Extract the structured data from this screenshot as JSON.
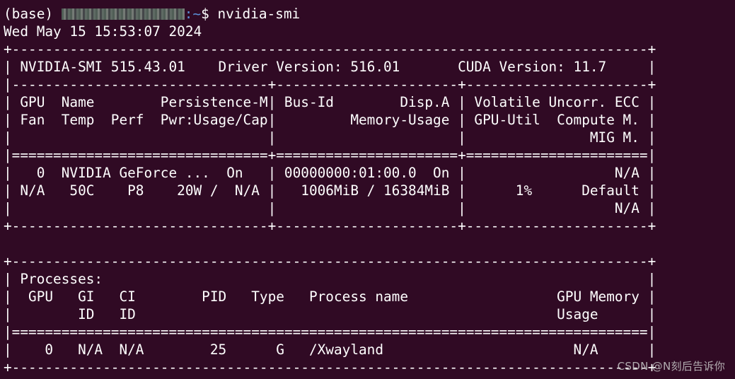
{
  "prompt": {
    "env": "(base) ",
    "path": ":~",
    "symbol": "$ ",
    "command": "nvidia-smi"
  },
  "output_lines": [
    "Wed May 15 15:53:07 2024",
    "+-----------------------------------------------------------------------------+",
    "| NVIDIA-SMI 515.43.01    Driver Version: 516.01       CUDA Version: 11.7     |",
    "|-------------------------------+----------------------+----------------------+",
    "| GPU  Name        Persistence-M| Bus-Id        Disp.A | Volatile Uncorr. ECC |",
    "| Fan  Temp  Perf  Pwr:Usage/Cap|         Memory-Usage | GPU-Util  Compute M. |",
    "|                               |                      |               MIG M. |",
    "|===============================+======================+======================|",
    "|   0  NVIDIA GeForce ...  On   | 00000000:01:00.0  On |                  N/A |",
    "| N/A   50C    P8    20W /  N/A |   1006MiB / 16384MiB |      1%      Default |",
    "|                               |                      |                  N/A |",
    "+-------------------------------+----------------------+----------------------+",
    "",
    "+-----------------------------------------------------------------------------+",
    "| Processes:                                                                  |",
    "|  GPU   GI   CI        PID   Type   Process name                  GPU Memory |",
    "|        ID   ID                                                   Usage      |",
    "|=============================================================================|",
    "|    0   N/A  N/A        25      G   /Xwayland                       N/A      |",
    "+-----------------------------------------------------------------------------+"
  ],
  "watermark": "CSDN @N刻后告诉你",
  "colors": {
    "background": "#300a24",
    "text": "#ffffff",
    "path": "#5b8fd6"
  }
}
